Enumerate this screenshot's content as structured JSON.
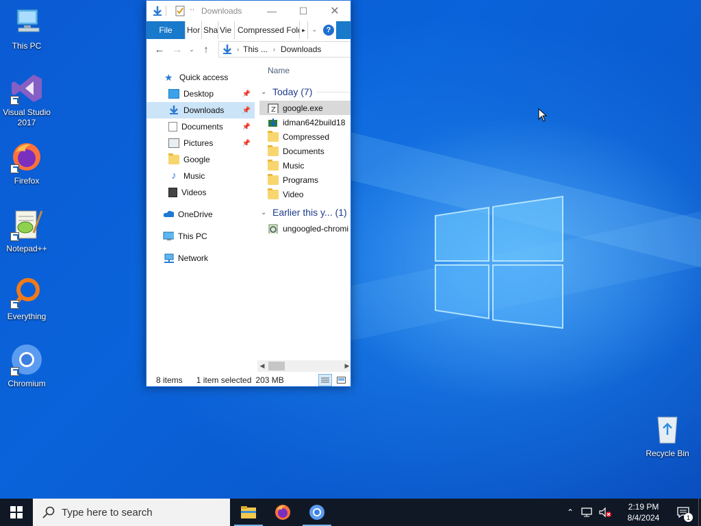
{
  "desktop": {
    "icons": [
      {
        "label": "This PC"
      },
      {
        "label": "Visual Studio 2017"
      },
      {
        "label": "Firefox"
      },
      {
        "label": "Notepad++"
      },
      {
        "label": "Everything"
      },
      {
        "label": "Chromium"
      }
    ],
    "recycle_bin": {
      "label": "Recycle Bin"
    }
  },
  "explorer": {
    "title": "Downloads",
    "ribbon_tabs": {
      "file": "File",
      "home": "Hor",
      "share": "Sha",
      "view": "Vie",
      "compressed": "Compressed Folde"
    },
    "address": {
      "this_pc": "This ...",
      "current": "Downloads"
    },
    "nav": {
      "quick_access": "Quick access",
      "desktop": "Desktop",
      "downloads": "Downloads",
      "documents": "Documents",
      "pictures": "Pictures",
      "google": "Google",
      "music": "Music",
      "videos": "Videos",
      "onedrive": "OneDrive",
      "this_pc": "This PC",
      "network": "Network"
    },
    "column_name": "Name",
    "groups": {
      "today": "Today (7)",
      "earlier": "Earlier this y... (1)"
    },
    "files": {
      "f1": "google.exe",
      "f2": "idman642build18",
      "f3": "Compressed",
      "f4": "Documents",
      "f5": "Music",
      "f6": "Programs",
      "f7": "Video",
      "f8": "ungoogled-chromi"
    },
    "status": {
      "items": "8 items",
      "selected": "1 item selected",
      "size": "203 MB"
    }
  },
  "taskbar": {
    "search_placeholder": "Type here to search",
    "time": "2:19 PM",
    "date": "8/4/2024",
    "notification_count": "1"
  },
  "icons": {
    "start": "windows-logo-icon",
    "search": "magnifier-icon",
    "file_explorer": "folder-icon",
    "firefox": "firefox-icon",
    "chromium": "chromium-icon"
  },
  "colors": {
    "accent": "#1979ca",
    "selection": "#cce4f7",
    "taskbar": "#101826"
  }
}
